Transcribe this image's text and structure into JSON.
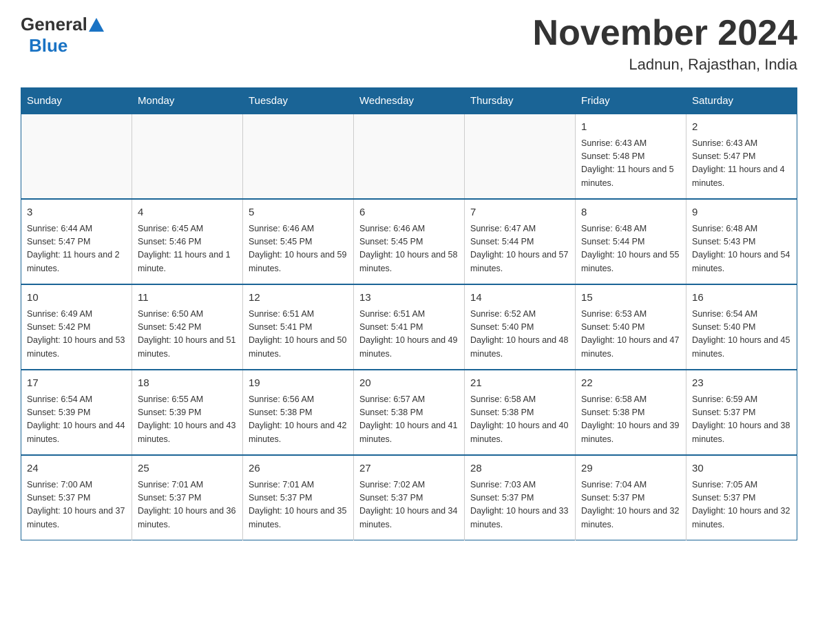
{
  "header": {
    "logo_general": "General",
    "logo_blue": "Blue",
    "month": "November 2024",
    "location": "Ladnun, Rajasthan, India"
  },
  "weekdays": [
    "Sunday",
    "Monday",
    "Tuesday",
    "Wednesday",
    "Thursday",
    "Friday",
    "Saturday"
  ],
  "weeks": [
    [
      {
        "day": "",
        "info": ""
      },
      {
        "day": "",
        "info": ""
      },
      {
        "day": "",
        "info": ""
      },
      {
        "day": "",
        "info": ""
      },
      {
        "day": "",
        "info": ""
      },
      {
        "day": "1",
        "info": "Sunrise: 6:43 AM\nSunset: 5:48 PM\nDaylight: 11 hours and 5 minutes."
      },
      {
        "day": "2",
        "info": "Sunrise: 6:43 AM\nSunset: 5:47 PM\nDaylight: 11 hours and 4 minutes."
      }
    ],
    [
      {
        "day": "3",
        "info": "Sunrise: 6:44 AM\nSunset: 5:47 PM\nDaylight: 11 hours and 2 minutes."
      },
      {
        "day": "4",
        "info": "Sunrise: 6:45 AM\nSunset: 5:46 PM\nDaylight: 11 hours and 1 minute."
      },
      {
        "day": "5",
        "info": "Sunrise: 6:46 AM\nSunset: 5:45 PM\nDaylight: 10 hours and 59 minutes."
      },
      {
        "day": "6",
        "info": "Sunrise: 6:46 AM\nSunset: 5:45 PM\nDaylight: 10 hours and 58 minutes."
      },
      {
        "day": "7",
        "info": "Sunrise: 6:47 AM\nSunset: 5:44 PM\nDaylight: 10 hours and 57 minutes."
      },
      {
        "day": "8",
        "info": "Sunrise: 6:48 AM\nSunset: 5:44 PM\nDaylight: 10 hours and 55 minutes."
      },
      {
        "day": "9",
        "info": "Sunrise: 6:48 AM\nSunset: 5:43 PM\nDaylight: 10 hours and 54 minutes."
      }
    ],
    [
      {
        "day": "10",
        "info": "Sunrise: 6:49 AM\nSunset: 5:42 PM\nDaylight: 10 hours and 53 minutes."
      },
      {
        "day": "11",
        "info": "Sunrise: 6:50 AM\nSunset: 5:42 PM\nDaylight: 10 hours and 51 minutes."
      },
      {
        "day": "12",
        "info": "Sunrise: 6:51 AM\nSunset: 5:41 PM\nDaylight: 10 hours and 50 minutes."
      },
      {
        "day": "13",
        "info": "Sunrise: 6:51 AM\nSunset: 5:41 PM\nDaylight: 10 hours and 49 minutes."
      },
      {
        "day": "14",
        "info": "Sunrise: 6:52 AM\nSunset: 5:40 PM\nDaylight: 10 hours and 48 minutes."
      },
      {
        "day": "15",
        "info": "Sunrise: 6:53 AM\nSunset: 5:40 PM\nDaylight: 10 hours and 47 minutes."
      },
      {
        "day": "16",
        "info": "Sunrise: 6:54 AM\nSunset: 5:40 PM\nDaylight: 10 hours and 45 minutes."
      }
    ],
    [
      {
        "day": "17",
        "info": "Sunrise: 6:54 AM\nSunset: 5:39 PM\nDaylight: 10 hours and 44 minutes."
      },
      {
        "day": "18",
        "info": "Sunrise: 6:55 AM\nSunset: 5:39 PM\nDaylight: 10 hours and 43 minutes."
      },
      {
        "day": "19",
        "info": "Sunrise: 6:56 AM\nSunset: 5:38 PM\nDaylight: 10 hours and 42 minutes."
      },
      {
        "day": "20",
        "info": "Sunrise: 6:57 AM\nSunset: 5:38 PM\nDaylight: 10 hours and 41 minutes."
      },
      {
        "day": "21",
        "info": "Sunrise: 6:58 AM\nSunset: 5:38 PM\nDaylight: 10 hours and 40 minutes."
      },
      {
        "day": "22",
        "info": "Sunrise: 6:58 AM\nSunset: 5:38 PM\nDaylight: 10 hours and 39 minutes."
      },
      {
        "day": "23",
        "info": "Sunrise: 6:59 AM\nSunset: 5:37 PM\nDaylight: 10 hours and 38 minutes."
      }
    ],
    [
      {
        "day": "24",
        "info": "Sunrise: 7:00 AM\nSunset: 5:37 PM\nDaylight: 10 hours and 37 minutes."
      },
      {
        "day": "25",
        "info": "Sunrise: 7:01 AM\nSunset: 5:37 PM\nDaylight: 10 hours and 36 minutes."
      },
      {
        "day": "26",
        "info": "Sunrise: 7:01 AM\nSunset: 5:37 PM\nDaylight: 10 hours and 35 minutes."
      },
      {
        "day": "27",
        "info": "Sunrise: 7:02 AM\nSunset: 5:37 PM\nDaylight: 10 hours and 34 minutes."
      },
      {
        "day": "28",
        "info": "Sunrise: 7:03 AM\nSunset: 5:37 PM\nDaylight: 10 hours and 33 minutes."
      },
      {
        "day": "29",
        "info": "Sunrise: 7:04 AM\nSunset: 5:37 PM\nDaylight: 10 hours and 32 minutes."
      },
      {
        "day": "30",
        "info": "Sunrise: 7:05 AM\nSunset: 5:37 PM\nDaylight: 10 hours and 32 minutes."
      }
    ]
  ]
}
